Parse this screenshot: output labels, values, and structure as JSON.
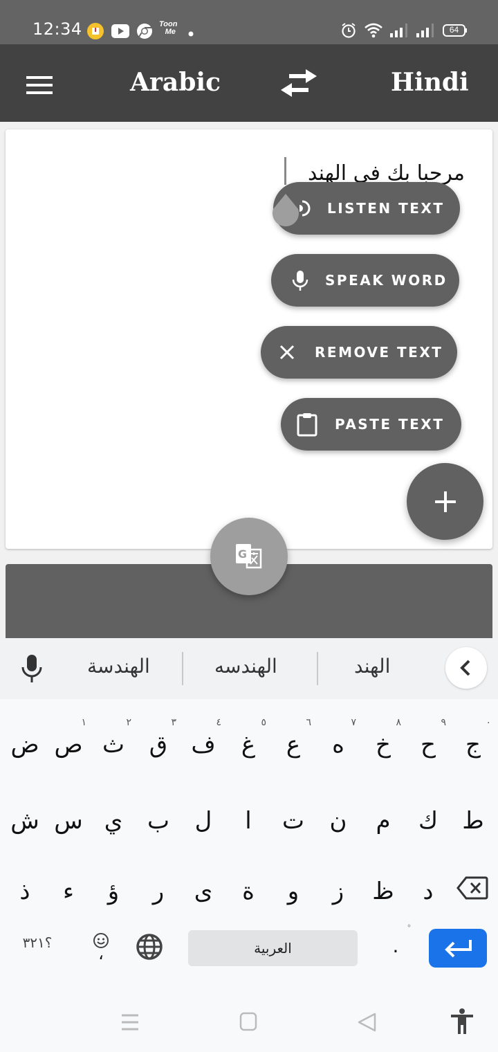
{
  "status_bar": {
    "time": "12:34",
    "notification_icons": [
      "download-icon",
      "youtube-icon",
      "chrome-icon",
      "toonme-icon",
      "dot-icon"
    ],
    "toonme_label_1": "Toon",
    "toonme_label_2": "Me",
    "system_icons": [
      "alarm-icon",
      "wifi-icon",
      "signal-icon",
      "signal-icon"
    ],
    "battery": "64"
  },
  "app_bar": {
    "source_language": "Arabic",
    "target_language": "Hindi",
    "menu_icon": "menu-icon",
    "swap_icon": "swap-icon"
  },
  "input": {
    "text": "مرحبا بك في الهند"
  },
  "fab_menu": {
    "items": [
      {
        "label": "LISTEN TEXT",
        "icon": "speaker-icon"
      },
      {
        "label": "SPEAK WORD",
        "icon": "microphone-icon"
      },
      {
        "label": "REMOVE TEXT",
        "icon": "close-icon"
      },
      {
        "label": "PASTE TEXT",
        "icon": "clipboard-icon"
      }
    ],
    "main_icon": "plus-icon",
    "translate_icon": "google-translate-icon"
  },
  "colors": {
    "app_bar": "#424242",
    "status_bar": "#646464",
    "fab": "#616161",
    "translate_fab": "#9e9e9e",
    "enter_key": "#1a73e8"
  },
  "keyboard": {
    "suggestions": [
      "الهند",
      "الهندسه",
      "الهندسة"
    ],
    "row1": [
      {
        "ch": "ج",
        "hint": "٠"
      },
      {
        "ch": "ح",
        "hint": "٩"
      },
      {
        "ch": "خ",
        "hint": "٨"
      },
      {
        "ch": "ه",
        "hint": "٧"
      },
      {
        "ch": "ع",
        "hint": "٦"
      },
      {
        "ch": "غ",
        "hint": "٥"
      },
      {
        "ch": "ف",
        "hint": "٤"
      },
      {
        "ch": "ق",
        "hint": "٣"
      },
      {
        "ch": "ث",
        "hint": "٢"
      },
      {
        "ch": "ص",
        "hint": "١"
      },
      {
        "ch": "ض",
        "hint": ""
      }
    ],
    "row2": [
      "ط",
      "ك",
      "م",
      "ن",
      "ت",
      "ا",
      "ل",
      "ب",
      "ي",
      "س",
      "ش"
    ],
    "row3": [
      "د",
      "ظ",
      "ز",
      "و",
      "ة",
      "ى",
      "ر",
      "ؤ",
      "ء",
      "ذ"
    ],
    "symbols_key": "؟٣٢١",
    "comma_key": "،",
    "period_key": ".",
    "period_hint": "ْ",
    "space_label": "العربية"
  },
  "nav_bar": {
    "icons": [
      "recents-icon",
      "home-icon",
      "back-icon",
      "accessibility-icon"
    ]
  }
}
